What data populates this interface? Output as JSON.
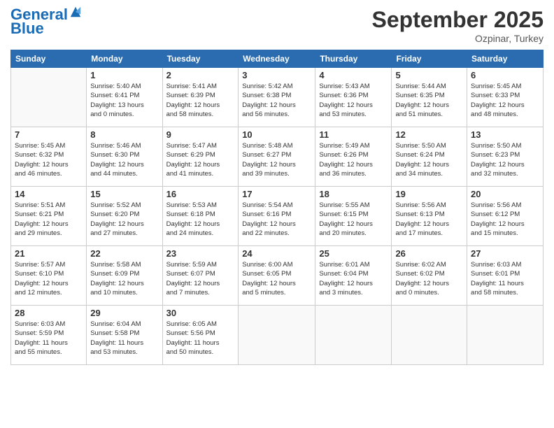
{
  "header": {
    "logo_line1": "General",
    "logo_line2": "Blue",
    "month": "September 2025",
    "location": "Ozpinar, Turkey"
  },
  "days_of_week": [
    "Sunday",
    "Monday",
    "Tuesday",
    "Wednesday",
    "Thursday",
    "Friday",
    "Saturday"
  ],
  "weeks": [
    [
      {
        "day": "",
        "info": ""
      },
      {
        "day": "1",
        "info": "Sunrise: 5:40 AM\nSunset: 6:41 PM\nDaylight: 13 hours\nand 0 minutes."
      },
      {
        "day": "2",
        "info": "Sunrise: 5:41 AM\nSunset: 6:39 PM\nDaylight: 12 hours\nand 58 minutes."
      },
      {
        "day": "3",
        "info": "Sunrise: 5:42 AM\nSunset: 6:38 PM\nDaylight: 12 hours\nand 56 minutes."
      },
      {
        "day": "4",
        "info": "Sunrise: 5:43 AM\nSunset: 6:36 PM\nDaylight: 12 hours\nand 53 minutes."
      },
      {
        "day": "5",
        "info": "Sunrise: 5:44 AM\nSunset: 6:35 PM\nDaylight: 12 hours\nand 51 minutes."
      },
      {
        "day": "6",
        "info": "Sunrise: 5:45 AM\nSunset: 6:33 PM\nDaylight: 12 hours\nand 48 minutes."
      }
    ],
    [
      {
        "day": "7",
        "info": "Sunrise: 5:45 AM\nSunset: 6:32 PM\nDaylight: 12 hours\nand 46 minutes."
      },
      {
        "day": "8",
        "info": "Sunrise: 5:46 AM\nSunset: 6:30 PM\nDaylight: 12 hours\nand 44 minutes."
      },
      {
        "day": "9",
        "info": "Sunrise: 5:47 AM\nSunset: 6:29 PM\nDaylight: 12 hours\nand 41 minutes."
      },
      {
        "day": "10",
        "info": "Sunrise: 5:48 AM\nSunset: 6:27 PM\nDaylight: 12 hours\nand 39 minutes."
      },
      {
        "day": "11",
        "info": "Sunrise: 5:49 AM\nSunset: 6:26 PM\nDaylight: 12 hours\nand 36 minutes."
      },
      {
        "day": "12",
        "info": "Sunrise: 5:50 AM\nSunset: 6:24 PM\nDaylight: 12 hours\nand 34 minutes."
      },
      {
        "day": "13",
        "info": "Sunrise: 5:50 AM\nSunset: 6:23 PM\nDaylight: 12 hours\nand 32 minutes."
      }
    ],
    [
      {
        "day": "14",
        "info": "Sunrise: 5:51 AM\nSunset: 6:21 PM\nDaylight: 12 hours\nand 29 minutes."
      },
      {
        "day": "15",
        "info": "Sunrise: 5:52 AM\nSunset: 6:20 PM\nDaylight: 12 hours\nand 27 minutes."
      },
      {
        "day": "16",
        "info": "Sunrise: 5:53 AM\nSunset: 6:18 PM\nDaylight: 12 hours\nand 24 minutes."
      },
      {
        "day": "17",
        "info": "Sunrise: 5:54 AM\nSunset: 6:16 PM\nDaylight: 12 hours\nand 22 minutes."
      },
      {
        "day": "18",
        "info": "Sunrise: 5:55 AM\nSunset: 6:15 PM\nDaylight: 12 hours\nand 20 minutes."
      },
      {
        "day": "19",
        "info": "Sunrise: 5:56 AM\nSunset: 6:13 PM\nDaylight: 12 hours\nand 17 minutes."
      },
      {
        "day": "20",
        "info": "Sunrise: 5:56 AM\nSunset: 6:12 PM\nDaylight: 12 hours\nand 15 minutes."
      }
    ],
    [
      {
        "day": "21",
        "info": "Sunrise: 5:57 AM\nSunset: 6:10 PM\nDaylight: 12 hours\nand 12 minutes."
      },
      {
        "day": "22",
        "info": "Sunrise: 5:58 AM\nSunset: 6:09 PM\nDaylight: 12 hours\nand 10 minutes."
      },
      {
        "day": "23",
        "info": "Sunrise: 5:59 AM\nSunset: 6:07 PM\nDaylight: 12 hours\nand 7 minutes."
      },
      {
        "day": "24",
        "info": "Sunrise: 6:00 AM\nSunset: 6:05 PM\nDaylight: 12 hours\nand 5 minutes."
      },
      {
        "day": "25",
        "info": "Sunrise: 6:01 AM\nSunset: 6:04 PM\nDaylight: 12 hours\nand 3 minutes."
      },
      {
        "day": "26",
        "info": "Sunrise: 6:02 AM\nSunset: 6:02 PM\nDaylight: 12 hours\nand 0 minutes."
      },
      {
        "day": "27",
        "info": "Sunrise: 6:03 AM\nSunset: 6:01 PM\nDaylight: 11 hours\nand 58 minutes."
      }
    ],
    [
      {
        "day": "28",
        "info": "Sunrise: 6:03 AM\nSunset: 5:59 PM\nDaylight: 11 hours\nand 55 minutes."
      },
      {
        "day": "29",
        "info": "Sunrise: 6:04 AM\nSunset: 5:58 PM\nDaylight: 11 hours\nand 53 minutes."
      },
      {
        "day": "30",
        "info": "Sunrise: 6:05 AM\nSunset: 5:56 PM\nDaylight: 11 hours\nand 50 minutes."
      },
      {
        "day": "",
        "info": ""
      },
      {
        "day": "",
        "info": ""
      },
      {
        "day": "",
        "info": ""
      },
      {
        "day": "",
        "info": ""
      }
    ]
  ]
}
